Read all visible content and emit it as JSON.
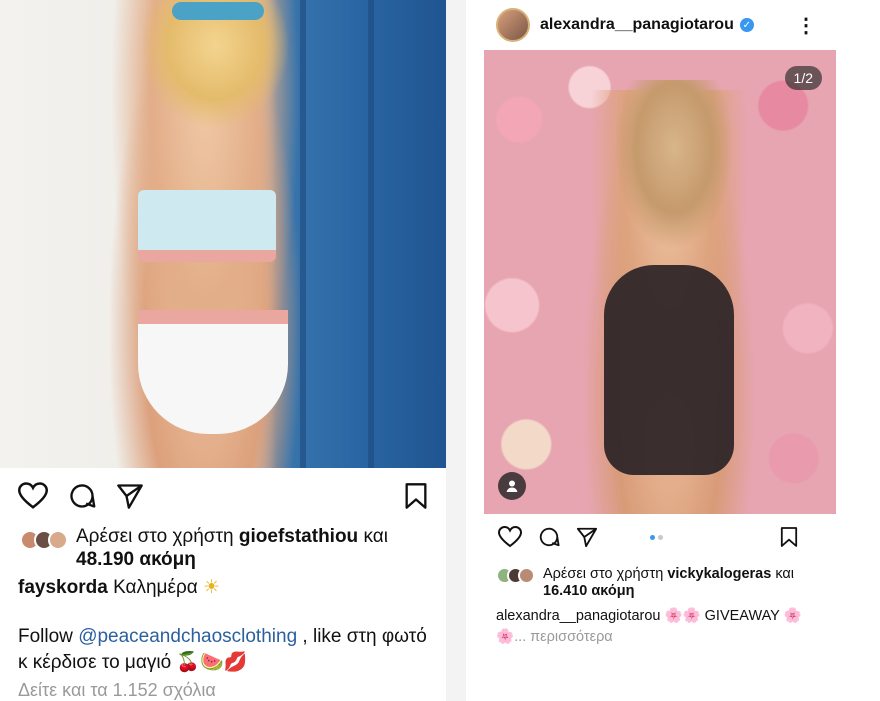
{
  "left_post": {
    "likes": {
      "prefix": "Αρέσει στο χρήστη",
      "user": "gioefstathiou",
      "connector": "και",
      "count": "48.190 ακόμη"
    },
    "caption": {
      "user": "fayskorda",
      "text": "Καλημέρα",
      "emoji": "☀"
    },
    "promo": {
      "lead": "Follow",
      "mention": "@peaceandchaosclothing",
      "rest": ", like στη φωτό κ κέρδισε το μαγιό",
      "emoji": "🍒🍉💋"
    },
    "comments_link": "Δείτε και τα 1.152 σχόλια"
  },
  "right_post": {
    "header": {
      "username": "alexandra__panagiotarou",
      "verified": "✓",
      "more": "⋮"
    },
    "image_counter": "1/2",
    "likes": {
      "prefix": "Αρέσει στο χρήστη",
      "user": "vickykalogeras",
      "connector": "και",
      "count": "16.410 ακόμη"
    },
    "caption": {
      "user": "alexandra__panagiotarou",
      "emoji_a": "🌸🌸",
      "text": "GIVEAWAY",
      "emoji_b": "🌸",
      "emoji_c": "🌸",
      "more_link": "... περισσότερα"
    }
  },
  "colors": {
    "link": "#2b5f9e",
    "muted": "#9a9a9a",
    "verified": "#3897f0"
  }
}
